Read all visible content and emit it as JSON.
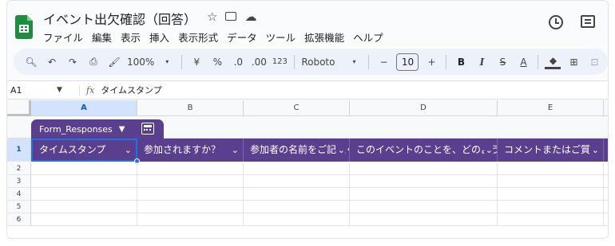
{
  "doc": {
    "title": "イベント出欠確認（回答）",
    "star_icon": "☆",
    "folder_icon": "▭",
    "cloud_icon": "☁"
  },
  "menu": [
    "ファイル",
    "編集",
    "表示",
    "挿入",
    "表示形式",
    "データ",
    "ツール",
    "拡張機能",
    "ヘルプ"
  ],
  "toolbar": {
    "zoom": "100%",
    "currency": "¥",
    "percent": "%",
    "dec_decrease": ".0",
    "dec_increase": ".00",
    "number_format": "123",
    "font": "Roboto",
    "font_size": "10",
    "minus": "−",
    "plus": "+",
    "bold": "B",
    "italic": "I",
    "strike": "S",
    "text_color": "A"
  },
  "formula_bar": {
    "cell_ref": "A1",
    "fx": "fx",
    "value": "タイムスタンプ"
  },
  "columns": [
    "A",
    "B",
    "C",
    "D",
    "E"
  ],
  "table": {
    "name": "Form_Responses",
    "color": "#5b3f8f"
  },
  "header_row_number": "1",
  "headers": [
    "タイムスタンプ",
    "参加されますか？",
    "参加者の名前をご記入ください",
    "このイベントのことを、どのようにして知りましたか？",
    "コメントまたはご質問"
  ],
  "row_numbers": [
    "2",
    "3",
    "4",
    "5",
    "6"
  ]
}
